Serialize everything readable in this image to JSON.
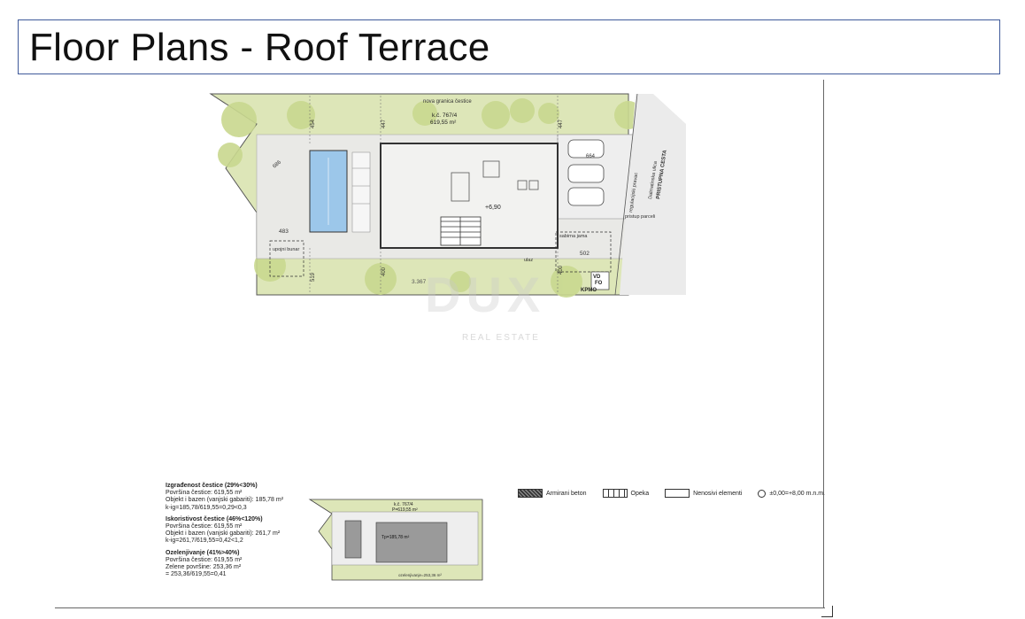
{
  "header": {
    "title": "Floor Plans  - Roof Terrace"
  },
  "watermark": {
    "logo": "DUX",
    "sub": "REAL ESTATE"
  },
  "plan": {
    "parcel_top_label": "nova granica čestice",
    "parcel_id": "k.č. 767/4",
    "parcel_area": "619,55 m²",
    "dims": [
      "454",
      "447",
      "447",
      "519",
      "400",
      "400"
    ],
    "pool_dim": "686",
    "left_dim": "483",
    "right_dim": "502",
    "bottom_dim": "3.367",
    "right_top_dim": "664",
    "elevation": "+6,90",
    "labels": {
      "upojni_bunar": "upojni bunar",
      "sabirna_jama": "sabirna jama",
      "ulaz": "ulaz",
      "regulacijski": "regulacijski pravac",
      "pristup": "pristup parceli",
      "street1": "Dalmatinska ulica",
      "street2": "PRISTUPNA CESTA",
      "vd": "VD",
      "fo": "FO",
      "kpmo": "KPMO"
    }
  },
  "stats": {
    "g1": {
      "title": "Izgrađenost čestice (29%<30%)",
      "l1": "Površina čestice: 619,55 m²",
      "l2": "Objekt i bazen (vanjski gabariti): 185,78 m²",
      "l3": "k-ig=185,78/619,55=0,29<0,3"
    },
    "g2": {
      "title": "Iskoristivost čestice (46%<120%)",
      "l1": "Površina čestice: 619,55 m²",
      "l2": "Objekt i bazen (vanjski gabariti): 261,7 m²",
      "l3": "k-ig=261,7/619,55=0,42<1,2"
    },
    "g3": {
      "title": "Ozelenjivanje (41%>40%)",
      "l1": "Površina čestice: 619,55 m²",
      "l2": "Zelene površine: 253,36 m²",
      "l3": "= 253,36/619,55=0,41"
    }
  },
  "mini_plan": {
    "parcel_id": "k.č. 767/4",
    "parcel_area": "P=619,55 m²",
    "tp": "Tp=185,78 m²",
    "green": "ozelenjivanje=253,36 m²"
  },
  "legend": {
    "armirani": "Armirani beton",
    "opeka": "Opeka",
    "nenosivi": "Nenosivi elementi",
    "level": "±0,00=+8,00 m.n.m."
  },
  "colors": {
    "green": "#dde6b8",
    "tree": "#c9d88f",
    "paving": "#e9e9e6",
    "pool": "#9cc7ea",
    "frame": "#3f5a9a"
  }
}
